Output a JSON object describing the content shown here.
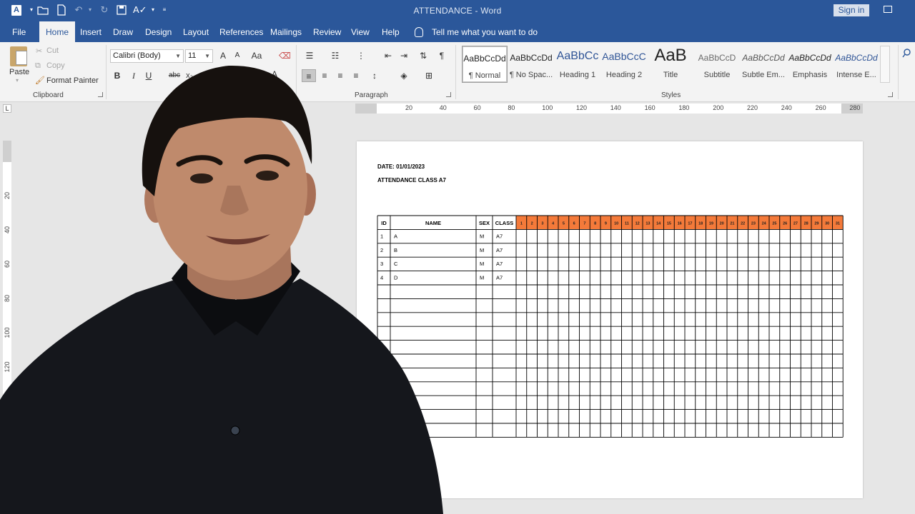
{
  "titlebar": {
    "logo": "A",
    "title": "ATTENDANCE  -  Word",
    "sign_in": "Sign in"
  },
  "tabs": [
    {
      "label": "File",
      "x": 0
    },
    {
      "label": "Home",
      "x": 1,
      "active": true
    },
    {
      "label": "Insert"
    },
    {
      "label": "Draw"
    },
    {
      "label": "Design"
    },
    {
      "label": "Layout"
    },
    {
      "label": "References"
    },
    {
      "label": "Mailings"
    },
    {
      "label": "Review"
    },
    {
      "label": "View"
    },
    {
      "label": "Help"
    }
  ],
  "tellme": "Tell me what you want to do",
  "clipboard": {
    "paste": "Paste",
    "cut": "Cut",
    "copy": "Copy",
    "format_painter": "Format Painter",
    "label": "Clipboard"
  },
  "font": {
    "name": "Calibri (Body)",
    "size": "11",
    "grow": "A",
    "shrink": "A",
    "case": "Aa",
    "bold": "B",
    "italic": "I",
    "underline": "U",
    "strike": "abc",
    "sub": "x₂",
    "color": "A"
  },
  "paragraph": {
    "label": "Paragraph",
    "pilcrow": "¶"
  },
  "styles": {
    "label": "Styles",
    "items": [
      {
        "sample": "AaBbCcDd",
        "name": "¶ Normal"
      },
      {
        "sample": "AaBbCcDd",
        "name": "¶ No Spac..."
      },
      {
        "sample": "AaBbCc",
        "name": "Heading 1"
      },
      {
        "sample": "AaBbCcC",
        "name": "Heading 2"
      },
      {
        "sample": "AaB",
        "name": "Title"
      },
      {
        "sample": "AaBbCcD",
        "name": "Subtitle"
      },
      {
        "sample": "AaBbCcDd",
        "name": "Subtle Em..."
      },
      {
        "sample": "AaBbCcDd",
        "name": "Emphasis"
      },
      {
        "sample": "AaBbCcDd",
        "name": "Intense E..."
      }
    ]
  },
  "ruler": {
    "h_labels": [
      "20",
      "40",
      "60",
      "80",
      "100",
      "120",
      "140",
      "160",
      "180",
      "200",
      "220",
      "240",
      "260",
      "280"
    ],
    "v_labels": [
      "20",
      "40",
      "60",
      "80",
      "100",
      "120"
    ]
  },
  "document": {
    "date": "DATE: 01/01/2023",
    "heading": "ATTENDANCE CLASS A7",
    "table": {
      "headers": [
        "ID",
        "NAME",
        "SEX",
        "CLASS"
      ],
      "days": [
        "1",
        "2",
        "3",
        "4",
        "5",
        "6",
        "7",
        "8",
        "9",
        "10",
        "11",
        "12",
        "13",
        "14",
        "15",
        "16",
        "17",
        "18",
        "19",
        "20",
        "21",
        "22",
        "23",
        "24",
        "25",
        "26",
        "27",
        "28",
        "29",
        "30",
        "31"
      ],
      "rows": [
        [
          "1",
          "A",
          "M",
          "A7"
        ],
        [
          "2",
          "B",
          "M",
          "A7"
        ],
        [
          "3",
          "C",
          "M",
          "A7"
        ],
        [
          "4",
          "D",
          "M",
          "A7"
        ],
        [
          "",
          "",
          "",
          ""
        ],
        [
          "",
          "",
          "",
          ""
        ],
        [
          "",
          "",
          "",
          ""
        ],
        [
          "",
          "",
          "",
          ""
        ],
        [
          "",
          "",
          "",
          ""
        ],
        [
          "",
          "",
          "",
          ""
        ],
        [
          "",
          "",
          "",
          ""
        ],
        [
          "",
          "",
          "",
          ""
        ],
        [
          "",
          "",
          "",
          ""
        ],
        [
          "",
          "",
          "",
          ""
        ],
        [
          "",
          "",
          "",
          ""
        ]
      ]
    }
  },
  "colors": {
    "word_blue": "#2b579a",
    "header_orange": "#f47a3a"
  }
}
